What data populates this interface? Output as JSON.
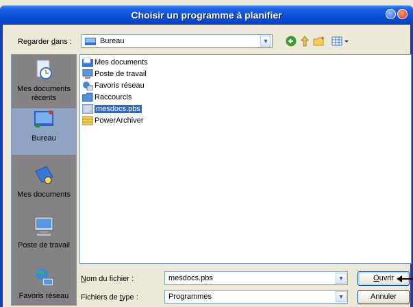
{
  "window": {
    "title": "Choisir un programme à planifier"
  },
  "lookin": {
    "label_pre": "Regarder ",
    "label_u": "d",
    "label_post": "ans :",
    "value": "Bureau"
  },
  "places": [
    {
      "label": "Mes documents récents"
    },
    {
      "label": "Bureau"
    },
    {
      "label": "Mes documents"
    },
    {
      "label": "Poste de travail"
    },
    {
      "label": "Favoris réseau"
    }
  ],
  "files": [
    {
      "name": "Mes documents",
      "icon": "my-documents-icon"
    },
    {
      "name": "Poste de travail",
      "icon": "computer-icon"
    },
    {
      "name": "Favoris réseau",
      "icon": "network-icon"
    },
    {
      "name": "Raccourcis",
      "icon": "folder-icon"
    },
    {
      "name": "mesdocs.pbs",
      "icon": "file-icon",
      "selected": true
    },
    {
      "name": "PowerArchiver",
      "icon": "archive-icon"
    }
  ],
  "filename": {
    "label_u": "N",
    "label_rest": "om du fichier :",
    "value": "mesdocs.pbs"
  },
  "filetype": {
    "label_pre": "Fichiers de ",
    "label_u": "t",
    "label_post": "ype :",
    "value": "Programmes"
  },
  "buttons": {
    "ok_u": "O",
    "ok_rest": "uvrir",
    "cancel": "Annuler"
  },
  "colors": {
    "titlebar": "#0a4fd8",
    "selection": "#316ac5",
    "dialog_bg": "#ece9d8"
  }
}
